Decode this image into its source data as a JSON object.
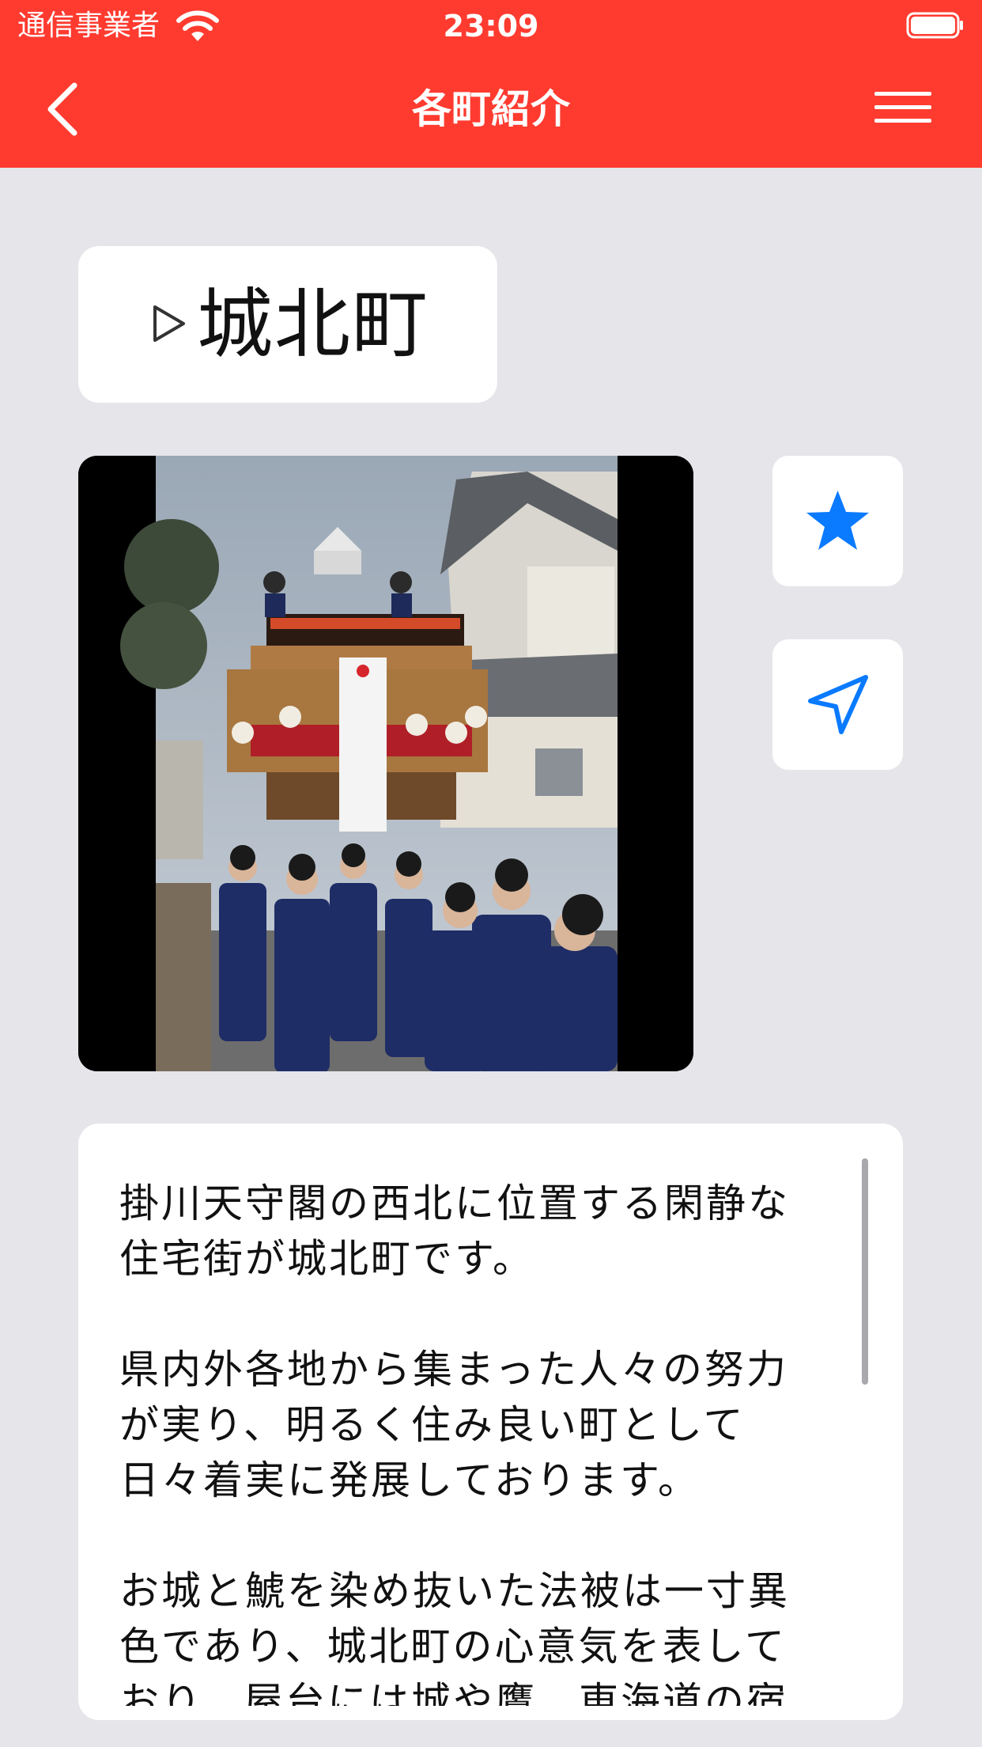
{
  "status_bar": {
    "carrier": "通信事業者",
    "time": "23:09"
  },
  "nav": {
    "title": "各町紹介",
    "back_icon": "chevron-left-icon",
    "menu_icon": "hamburger-icon"
  },
  "town": {
    "name": "城北町"
  },
  "photo": {
    "alt": "城北町の屋台と祭り衆"
  },
  "actions": {
    "favorite_icon": "star-icon",
    "map_icon": "location-arrow-icon"
  },
  "description": {
    "paragraphs": [
      "掛川天守閣の西北に位置する閑静な\n住宅街が城北町です。",
      "県内外各地から集まった人々の努力\nが実り、明るく住み良い町として\n日々着実に発展しております。",
      "お城と鯱を染め抜いた法被は一寸異\n色であり、城北町の心意気を表して\nおり、屋台には城や鷹、東海道の宿"
    ]
  },
  "colors": {
    "accent": "#ff3b30",
    "icon_blue": "#0a7aff",
    "background": "#e5e5ea"
  }
}
